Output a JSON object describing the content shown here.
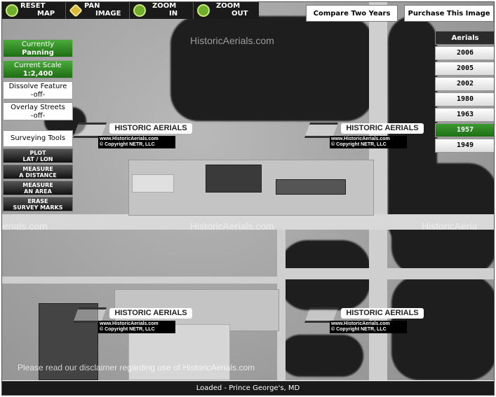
{
  "toolbar": {
    "reset": {
      "line1": "RESET",
      "line2": "MAP"
    },
    "pan": {
      "line1": "PAN",
      "line2": "IMAGE"
    },
    "zoom_in": {
      "line1": "ZOOM",
      "line2": "IN"
    },
    "zoom_out": {
      "line1": "ZOOM",
      "line2": "OUT"
    }
  },
  "top_buttons": {
    "compare": "Compare Two Years",
    "purchase": "Purchase This Image"
  },
  "aerials": {
    "header": "Aerials",
    "years": [
      "2006",
      "2005",
      "2002",
      "1980",
      "1963",
      "1957",
      "1949"
    ],
    "active_year": "1957"
  },
  "status": {
    "currently_label": "Currently",
    "currently_value": "Panning",
    "scale_label": "Current Scale",
    "scale_value": "1:2,400",
    "dissolve_label": "Dissolve Feature",
    "dissolve_value": "-off-",
    "overlay_label": "Overlay Streets",
    "overlay_value": "-off-"
  },
  "tools": {
    "header": "Surveying Tools",
    "items": [
      {
        "line1": "PLOT",
        "line2": "LAT / LON"
      },
      {
        "line1": "MEASURE",
        "line2": "A DISTANCE"
      },
      {
        "line1": "MEASURE",
        "line2": "AN AREA"
      },
      {
        "line1": "ERASE",
        "line2": "SURVEY MARKS"
      }
    ]
  },
  "watermark": {
    "site": "HistoricAerials.com",
    "site_fragment_left": "erials.com",
    "site_fragment_right": "HistoricAeria",
    "banner": "HISTORIC AERIALS",
    "url": "www.HistoricAerials.com",
    "copyright": "© Copyright NETR, LLC"
  },
  "disclaimer": "Please read our disclaimer regarding use of HistoricAerials.com",
  "statusbar": "Loaded - Prince George's, MD"
}
